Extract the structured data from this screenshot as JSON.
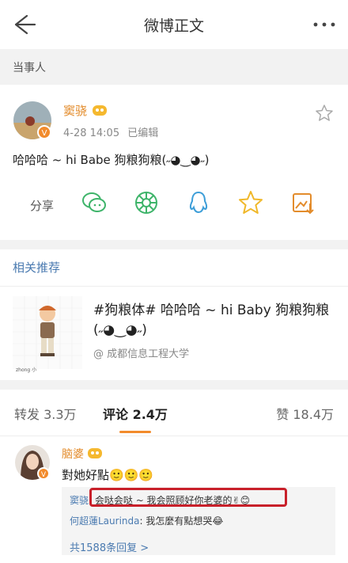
{
  "nav": {
    "title": "微博正文"
  },
  "section": {
    "label": "当事人"
  },
  "post": {
    "author": "窦骁",
    "time": "4-28 14:05",
    "edited": "已编辑",
    "text": "哈哈哈 ~ hi Babe 狗粮狗粮(˶◕‿◕˶)",
    "share_label": "分享"
  },
  "recommend": {
    "heading": "相关推荐",
    "title": "#狗粮体#   哈哈哈 ~ hi Baby 狗粮狗粮(˶◕‿◕˶)",
    "source": "@ 成都信息工程大学",
    "thumb_caption": "zhong 小"
  },
  "tabs": {
    "repost": "转发 3.3万",
    "comment": "评论 2.4万",
    "like": "赞 18.4万"
  },
  "comment": {
    "author": "脑婆",
    "text": "對她好點🙂🙂🙂",
    "replies": [
      {
        "who": "窦骁",
        "text": ": 会哒会哒 ~ 我会照顾好你老婆的✌😊"
      },
      {
        "who": "何超蓮Laurinda",
        "text": ": 我怎麼有點想哭😂"
      }
    ],
    "more": "共1588条回复 >"
  },
  "colors": {
    "accent": "#f28b2c",
    "link": "#4a7ab0",
    "highlight": "#c8202a"
  }
}
